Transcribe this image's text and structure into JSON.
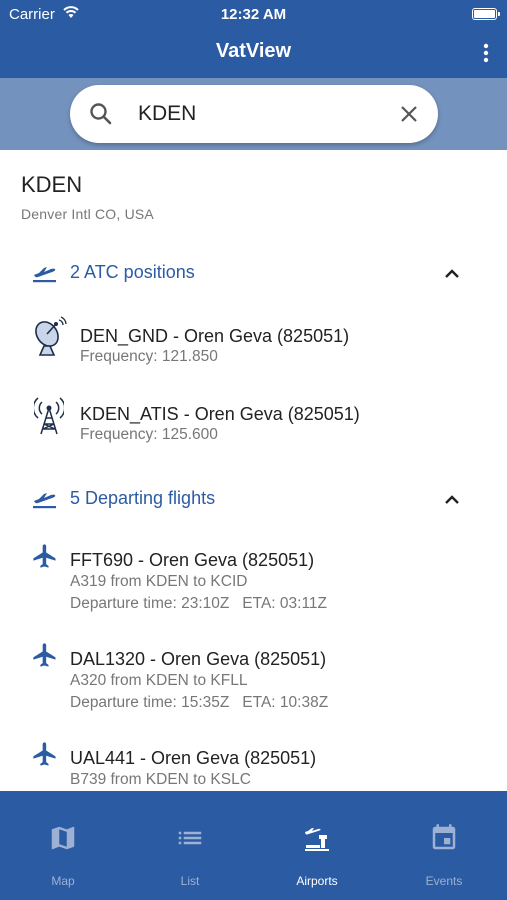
{
  "status": {
    "carrier": "Carrier",
    "time": "12:32 AM"
  },
  "app": {
    "title": "VatView"
  },
  "search": {
    "value": "KDEN",
    "placeholder": ""
  },
  "airport": {
    "code": "KDEN",
    "name": "Denver Intl CO, USA"
  },
  "atc_section": {
    "title": "2 ATC positions",
    "collapsed": false
  },
  "atc": [
    {
      "title": "DEN_GND - Oren Geva (825051)",
      "frequency": "Frequency: 121.850",
      "icon": "radar-dish-icon"
    },
    {
      "title": "KDEN_ATIS - Oren Geva (825051)",
      "frequency": "Frequency: 125.600",
      "icon": "radio-tower-icon"
    }
  ],
  "dep_section": {
    "title": "5 Departing flights",
    "collapsed": false
  },
  "flights": [
    {
      "title": "FFT690 - Oren Geva (825051)",
      "route": "A319 from KDEN to KCID",
      "times": "Departure time: 23:10Z   ETA: 03:11Z"
    },
    {
      "title": "DAL1320 - Oren Geva (825051)",
      "route": "A320 from KDEN to KFLL",
      "times": "Departure time: 15:35Z   ETA: 10:38Z"
    },
    {
      "title": "UAL441 - Oren Geva (825051)",
      "route": "B739 from KDEN to KSLC",
      "times": ""
    }
  ],
  "tabs": [
    {
      "label": "Map",
      "icon": "map-icon",
      "active": false
    },
    {
      "label": "List",
      "icon": "list-icon",
      "active": false
    },
    {
      "label": "Airports",
      "icon": "airport-icon",
      "active": true
    },
    {
      "label": "Events",
      "icon": "calendar-icon",
      "active": false
    }
  ],
  "colors": {
    "primary": "#2b5ba3",
    "search_band": "#7392bd",
    "inactive_tab": "#9db1d4",
    "muted_text": "#777777"
  }
}
